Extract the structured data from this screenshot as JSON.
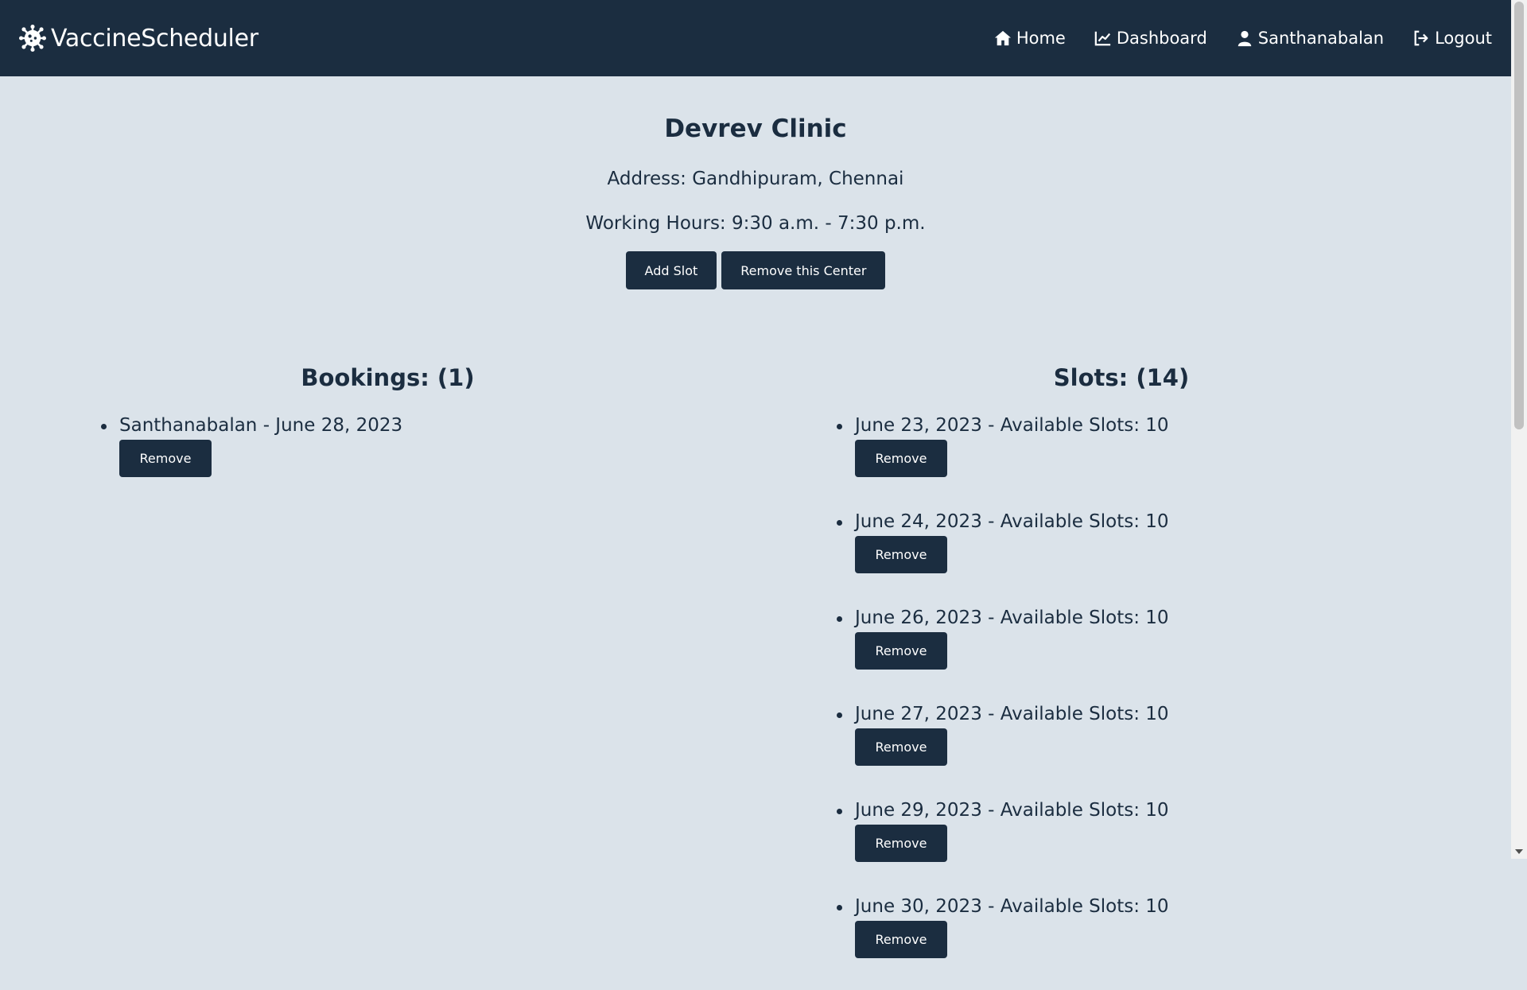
{
  "colors": {
    "primary": "#1b2d40",
    "background": "#dbe3ea",
    "text_on_primary": "#ffffff"
  },
  "nav": {
    "brand": "VaccineScheduler",
    "brand_icon": "virus-icon",
    "links": [
      {
        "label": "Home",
        "icon": "home-icon"
      },
      {
        "label": "Dashboard",
        "icon": "chart-line-icon"
      },
      {
        "label": "Santhanabalan",
        "icon": "user-icon"
      },
      {
        "label": "Logout",
        "icon": "logout-icon"
      }
    ]
  },
  "center": {
    "name": "Devrev Clinic",
    "address": "Address: Gandhipuram, Chennai",
    "hours": "Working Hours: 9:30 a.m. - 7:30 p.m.",
    "add_slot_label": "Add Slot",
    "remove_center_label": "Remove this Center"
  },
  "bookings": {
    "title": "Bookings: (1)",
    "items": [
      {
        "text": "Santhanabalan - June 28, 2023",
        "button": "Remove"
      }
    ]
  },
  "slots": {
    "title": "Slots: (14)",
    "items": [
      {
        "text": "June 23, 2023 - Available Slots: 10",
        "button": "Remove"
      },
      {
        "text": "June 24, 2023 - Available Slots: 10",
        "button": "Remove"
      },
      {
        "text": "June 26, 2023 - Available Slots: 10",
        "button": "Remove"
      },
      {
        "text": "June 27, 2023 - Available Slots: 10",
        "button": "Remove"
      },
      {
        "text": "June 29, 2023 - Available Slots: 10",
        "button": "Remove"
      },
      {
        "text": "June 30, 2023 - Available Slots: 10",
        "button": "Remove"
      }
    ]
  }
}
